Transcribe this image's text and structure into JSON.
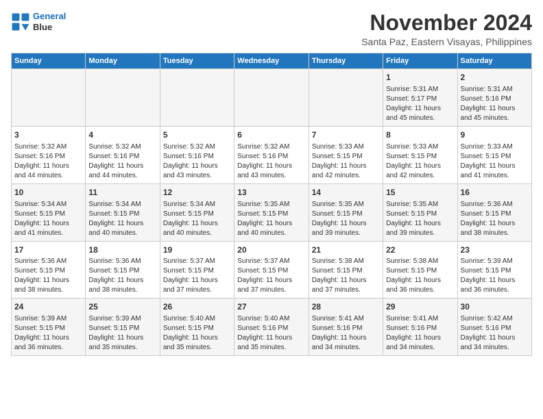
{
  "header": {
    "logo_line1": "General",
    "logo_line2": "Blue",
    "month_title": "November 2024",
    "location": "Santa Paz, Eastern Visayas, Philippines"
  },
  "days_of_week": [
    "Sunday",
    "Monday",
    "Tuesday",
    "Wednesday",
    "Thursday",
    "Friday",
    "Saturday"
  ],
  "weeks": [
    [
      {
        "day": "",
        "info": ""
      },
      {
        "day": "",
        "info": ""
      },
      {
        "day": "",
        "info": ""
      },
      {
        "day": "",
        "info": ""
      },
      {
        "day": "",
        "info": ""
      },
      {
        "day": "1",
        "info": "Sunrise: 5:31 AM\nSunset: 5:17 PM\nDaylight: 11 hours\nand 45 minutes."
      },
      {
        "day": "2",
        "info": "Sunrise: 5:31 AM\nSunset: 5:16 PM\nDaylight: 11 hours\nand 45 minutes."
      }
    ],
    [
      {
        "day": "3",
        "info": "Sunrise: 5:32 AM\nSunset: 5:16 PM\nDaylight: 11 hours\nand 44 minutes."
      },
      {
        "day": "4",
        "info": "Sunrise: 5:32 AM\nSunset: 5:16 PM\nDaylight: 11 hours\nand 44 minutes."
      },
      {
        "day": "5",
        "info": "Sunrise: 5:32 AM\nSunset: 5:16 PM\nDaylight: 11 hours\nand 43 minutes."
      },
      {
        "day": "6",
        "info": "Sunrise: 5:32 AM\nSunset: 5:16 PM\nDaylight: 11 hours\nand 43 minutes."
      },
      {
        "day": "7",
        "info": "Sunrise: 5:33 AM\nSunset: 5:15 PM\nDaylight: 11 hours\nand 42 minutes."
      },
      {
        "day": "8",
        "info": "Sunrise: 5:33 AM\nSunset: 5:15 PM\nDaylight: 11 hours\nand 42 minutes."
      },
      {
        "day": "9",
        "info": "Sunrise: 5:33 AM\nSunset: 5:15 PM\nDaylight: 11 hours\nand 41 minutes."
      }
    ],
    [
      {
        "day": "10",
        "info": "Sunrise: 5:34 AM\nSunset: 5:15 PM\nDaylight: 11 hours\nand 41 minutes."
      },
      {
        "day": "11",
        "info": "Sunrise: 5:34 AM\nSunset: 5:15 PM\nDaylight: 11 hours\nand 40 minutes."
      },
      {
        "day": "12",
        "info": "Sunrise: 5:34 AM\nSunset: 5:15 PM\nDaylight: 11 hours\nand 40 minutes."
      },
      {
        "day": "13",
        "info": "Sunrise: 5:35 AM\nSunset: 5:15 PM\nDaylight: 11 hours\nand 40 minutes."
      },
      {
        "day": "14",
        "info": "Sunrise: 5:35 AM\nSunset: 5:15 PM\nDaylight: 11 hours\nand 39 minutes."
      },
      {
        "day": "15",
        "info": "Sunrise: 5:35 AM\nSunset: 5:15 PM\nDaylight: 11 hours\nand 39 minutes."
      },
      {
        "day": "16",
        "info": "Sunrise: 5:36 AM\nSunset: 5:15 PM\nDaylight: 11 hours\nand 38 minutes."
      }
    ],
    [
      {
        "day": "17",
        "info": "Sunrise: 5:36 AM\nSunset: 5:15 PM\nDaylight: 11 hours\nand 38 minutes."
      },
      {
        "day": "18",
        "info": "Sunrise: 5:36 AM\nSunset: 5:15 PM\nDaylight: 11 hours\nand 38 minutes."
      },
      {
        "day": "19",
        "info": "Sunrise: 5:37 AM\nSunset: 5:15 PM\nDaylight: 11 hours\nand 37 minutes."
      },
      {
        "day": "20",
        "info": "Sunrise: 5:37 AM\nSunset: 5:15 PM\nDaylight: 11 hours\nand 37 minutes."
      },
      {
        "day": "21",
        "info": "Sunrise: 5:38 AM\nSunset: 5:15 PM\nDaylight: 11 hours\nand 37 minutes."
      },
      {
        "day": "22",
        "info": "Sunrise: 5:38 AM\nSunset: 5:15 PM\nDaylight: 11 hours\nand 36 minutes."
      },
      {
        "day": "23",
        "info": "Sunrise: 5:39 AM\nSunset: 5:15 PM\nDaylight: 11 hours\nand 36 minutes."
      }
    ],
    [
      {
        "day": "24",
        "info": "Sunrise: 5:39 AM\nSunset: 5:15 PM\nDaylight: 11 hours\nand 36 minutes."
      },
      {
        "day": "25",
        "info": "Sunrise: 5:39 AM\nSunset: 5:15 PM\nDaylight: 11 hours\nand 35 minutes."
      },
      {
        "day": "26",
        "info": "Sunrise: 5:40 AM\nSunset: 5:15 PM\nDaylight: 11 hours\nand 35 minutes."
      },
      {
        "day": "27",
        "info": "Sunrise: 5:40 AM\nSunset: 5:16 PM\nDaylight: 11 hours\nand 35 minutes."
      },
      {
        "day": "28",
        "info": "Sunrise: 5:41 AM\nSunset: 5:16 PM\nDaylight: 11 hours\nand 34 minutes."
      },
      {
        "day": "29",
        "info": "Sunrise: 5:41 AM\nSunset: 5:16 PM\nDaylight: 11 hours\nand 34 minutes."
      },
      {
        "day": "30",
        "info": "Sunrise: 5:42 AM\nSunset: 5:16 PM\nDaylight: 11 hours\nand 34 minutes."
      }
    ]
  ]
}
